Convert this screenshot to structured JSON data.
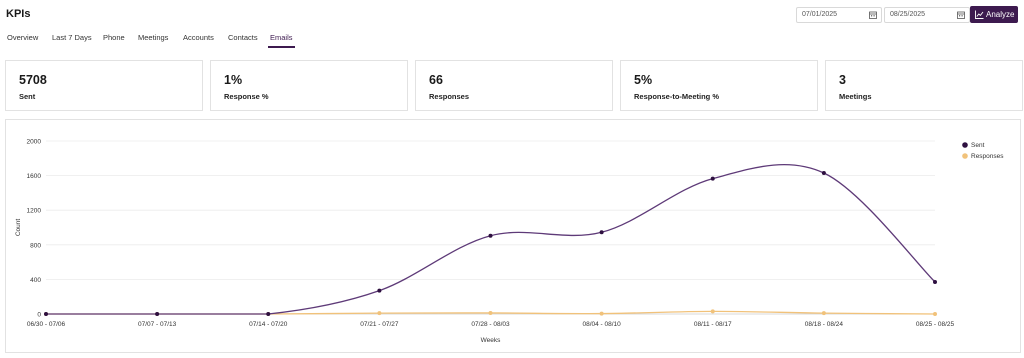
{
  "page_title": "KPIs",
  "date_range": {
    "start": "07/01/2025",
    "end": "08/25/2025"
  },
  "analyze_label": "Analyze",
  "tabs": [
    {
      "label": "Overview",
      "active": false
    },
    {
      "label": "Last 7 Days",
      "active": false
    },
    {
      "label": "Phone",
      "active": false
    },
    {
      "label": "Meetings",
      "active": false
    },
    {
      "label": "Accounts",
      "active": false
    },
    {
      "label": "Contacts",
      "active": false
    },
    {
      "label": "Emails",
      "active": true
    }
  ],
  "kpis": [
    {
      "value": "5708",
      "label": "Sent"
    },
    {
      "value": "1%",
      "label": "Response %"
    },
    {
      "value": "66",
      "label": "Responses"
    },
    {
      "value": "5%",
      "label": "Response-to-Meeting %"
    },
    {
      "value": "3",
      "label": "Meetings"
    }
  ],
  "colors": {
    "accent": "#3d1a4f",
    "sent": "#5e3a78",
    "responses": "#f1c27a",
    "grid": "#ececec"
  },
  "chart_data": {
    "type": "line",
    "xlabel": "Weeks",
    "ylabel": "Count",
    "ylim": [
      0,
      2000
    ],
    "yticks": [
      0,
      400,
      800,
      1200,
      1600,
      2000
    ],
    "categories": [
      "06/30 - 07/06",
      "07/07 - 07/13",
      "07/14 - 07/20",
      "07/21 - 07/27",
      "07/28 - 08/03",
      "08/04 - 08/10",
      "08/11 - 08/17",
      "08/18 - 08/24",
      "08/25 - 08/25"
    ],
    "series": [
      {
        "name": "Sent",
        "color": "#5e3a78",
        "values": [
          0,
          0,
          0,
          270,
          905,
          945,
          1565,
          1630,
          370
        ]
      },
      {
        "name": "Responses",
        "color": "#f1c27a",
        "values": [
          0,
          0,
          0,
          10,
          12,
          5,
          30,
          10,
          0
        ]
      }
    ],
    "legend_position": "top-right",
    "grid": true
  }
}
